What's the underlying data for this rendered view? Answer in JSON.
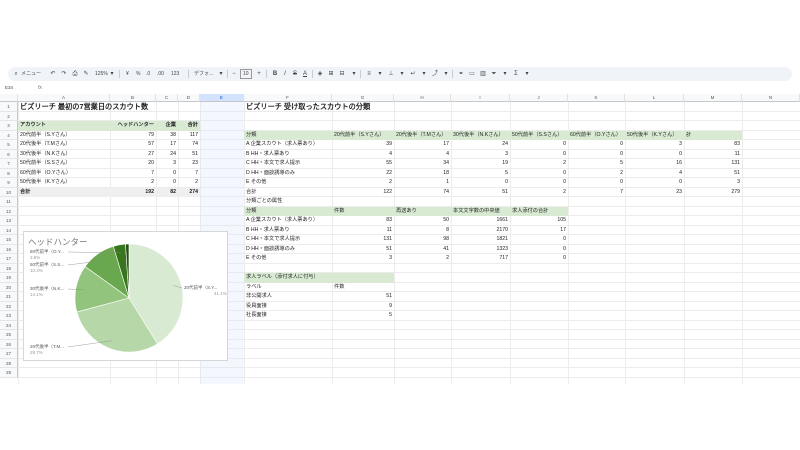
{
  "toolbar": {
    "menu_label": "メニュー",
    "zoom": "125%",
    "currency": "¥",
    "percent": "%",
    "decimal_less": ".0",
    "decimal_more": ".00",
    "number_format": "123",
    "font_name": "デフォ...",
    "font_size": "10"
  },
  "formula_bar": {
    "name_box": "E34",
    "fx": "fx"
  },
  "columns": [
    "A",
    "B",
    "C",
    "D",
    "E",
    "F",
    "G",
    "H",
    "I",
    "J",
    "K",
    "L",
    "M",
    "N"
  ],
  "selected_column": "E",
  "rows": [
    "1",
    "2",
    "3",
    "4",
    "5",
    "6",
    "7",
    "8",
    "9",
    "10",
    "11",
    "12",
    "13",
    "14",
    "15",
    "16",
    "17",
    "18",
    "19",
    "20",
    "21",
    "22",
    "23",
    "24",
    "25",
    "26",
    "27",
    "28",
    "29"
  ],
  "left": {
    "title": "ビズリーチ 最初の7営業日のスカウト数",
    "headers": [
      "アカウント",
      "ヘッドハンター",
      "企業",
      "合計"
    ],
    "rows": [
      [
        "20代前半（S.Yさん）",
        "79",
        "38",
        "117"
      ],
      [
        "20代後半（T.Mさん）",
        "57",
        "17",
        "74"
      ],
      [
        "30代後半（N.Kさん）",
        "27",
        "24",
        "51"
      ],
      [
        "50代前半（S.Sさん）",
        "20",
        "3",
        "23"
      ],
      [
        "60代前半（O.Yさん）",
        "7",
        "0",
        "7"
      ],
      [
        "50代後半（K.Yさん）",
        "2",
        "0",
        "2"
      ]
    ],
    "total": [
      "合計",
      "192",
      "82",
      "274"
    ]
  },
  "right": {
    "title": "ビズリーチ 受け取ったスカウトの分類",
    "headers": [
      "分類",
      "20代前半（S.Yさん）",
      "20代後半（T.Mさん）",
      "30代後半（N.Kさん）",
      "50代前半（S.Sさん）",
      "60代前半（O.Yさん）",
      "50代後半（K.Yさん）",
      "計"
    ],
    "rows": [
      [
        "A 企業スカウト（求人票あり）",
        "39",
        "17",
        "24",
        "0",
        "0",
        "3",
        "83"
      ],
      [
        "B HH・求人票あり",
        "4",
        "4",
        "3",
        "0",
        "0",
        "0",
        "11"
      ],
      [
        "C HH・本文で求人提示",
        "55",
        "34",
        "19",
        "2",
        "5",
        "16",
        "131"
      ],
      [
        "D HH・面談誘導のみ",
        "22",
        "18",
        "5",
        "0",
        "2",
        "4",
        "51"
      ],
      [
        "E その他",
        "2",
        "1",
        "0",
        "0",
        "0",
        "0",
        "3"
      ]
    ],
    "total": [
      "合計",
      "122",
      "74",
      "51",
      "2",
      "7",
      "23",
      "279"
    ],
    "attr_title": "分類ごとの属性",
    "attr_headers": [
      "分類",
      "件数",
      "再送あり",
      "本文文字数の中央値",
      "求人添付の合計"
    ],
    "attr_rows": [
      [
        "A 企業スカウト（求人票あり）",
        "83",
        "50",
        "1661",
        "105"
      ],
      [
        "B HH・求人票あり",
        "11",
        "8",
        "2170",
        "17"
      ],
      [
        "C HH・本文で求人提示",
        "131",
        "98",
        "1821",
        "0"
      ],
      [
        "D HH・面談誘導のみ",
        "51",
        "41",
        "1323",
        "0"
      ],
      [
        "E その他",
        "3",
        "2",
        "717",
        "0"
      ]
    ],
    "label_title": "求人ラベル（添付求人に付与）",
    "label_headers": [
      "ラベル",
      "件数"
    ],
    "label_rows": [
      [
        "非公開求人",
        "51"
      ],
      [
        "役員面接",
        "9"
      ],
      [
        "社長面接",
        "5"
      ]
    ]
  },
  "colors": {
    "header_band": "#d9ead3",
    "total_band": "#efefef",
    "selected_col": "#d3e3fd",
    "pie": [
      "#d9ead3",
      "#b6d7a8",
      "#93c47d",
      "#6aa84f",
      "#38761d",
      "#274e13"
    ]
  },
  "chart_data": {
    "type": "pie",
    "title": "ヘッドハンター",
    "labels": [
      "20代前半（S.Y...",
      "20代後半（T.M...",
      "30代後半（N.K...",
      "50代前半（S.S...",
      "60代前半（O.Y...",
      "50代後半（K.Y..."
    ],
    "values": [
      79,
      57,
      27,
      20,
      7,
      2
    ],
    "percent_labels": [
      "41.1%",
      "29.7%",
      "14.1%",
      "10.4%",
      "3.6%",
      ""
    ],
    "legend": "none"
  }
}
